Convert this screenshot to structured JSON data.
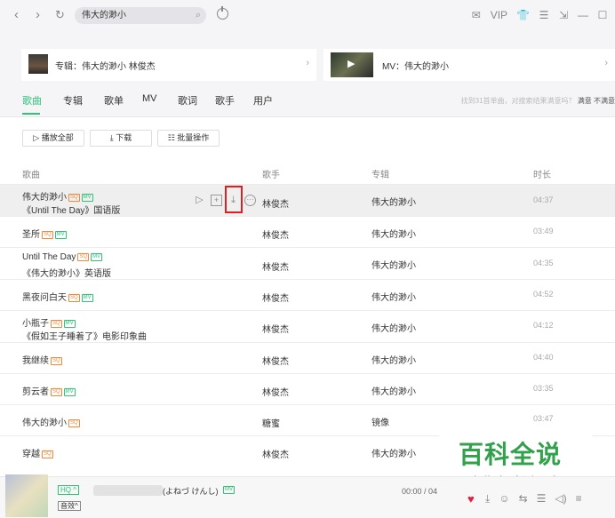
{
  "topbar": {
    "back": "‹",
    "forward": "›",
    "refresh": "↻",
    "search_value": "伟大的渺小",
    "search_icon": "⌕",
    "right_icons": [
      "✉",
      "VIP",
      "👕",
      "☰",
      "⇲",
      "—",
      "☐"
    ]
  },
  "cards": {
    "album_text": "专辑：伟大的渺小    林俊杰",
    "mv_text": "MV：伟大的渺小",
    "chevron": "›"
  },
  "tabs": [
    "歌曲",
    "专辑",
    "歌单",
    "MV",
    "歌词",
    "歌手",
    "用户"
  ],
  "feedback": {
    "text": "找到31首单曲，对搜索结果满意吗？",
    "yes": "满意",
    "no": "不满意"
  },
  "actions": {
    "play_all": "▷ 播放全部",
    "download": "⤓ 下载",
    "batch": "☷ 批量操作"
  },
  "table": {
    "headers": [
      "歌曲",
      "歌手",
      "专辑",
      "时长"
    ],
    "badge_sq": "SQ",
    "badge_mv": "MV",
    "rows": [
      {
        "title": "伟大的渺小",
        "subtitle": "《Until The Day》国语版",
        "singer": "林俊杰",
        "album": "伟大的渺小",
        "duration": "04:37"
      },
      {
        "title": "圣所",
        "subtitle": "",
        "singer": "林俊杰",
        "album": "伟大的渺小",
        "duration": "03:49"
      },
      {
        "title": "Until The Day",
        "subtitle": "《伟大的渺小》英语版",
        "singer": "林俊杰",
        "album": "伟大的渺小",
        "duration": "04:35"
      },
      {
        "title": "黑夜问白天",
        "subtitle": "",
        "singer": "林俊杰",
        "album": "伟大的渺小",
        "duration": "04:52"
      },
      {
        "title": "小瓶子",
        "subtitle": "《假如王子睡着了》电影印象曲",
        "singer": "林俊杰",
        "album": "伟大的渺小",
        "duration": "04:12"
      },
      {
        "title": "我继续",
        "subtitle": "",
        "singer": "林俊杰",
        "album": "伟大的渺小",
        "duration": "04:40"
      },
      {
        "title": "剪云者",
        "subtitle": "",
        "singer": "林俊杰",
        "album": "伟大的渺小",
        "duration": "03:35"
      },
      {
        "title": "伟大的渺小",
        "subtitle": "",
        "singer": "糖蜜",
        "album": "镜像",
        "duration": "03:47"
      },
      {
        "title": "穿越",
        "subtitle": "",
        "singer": "林俊杰",
        "album": "伟大的渺小",
        "duration": ""
      }
    ]
  },
  "watermark": {
    "title": "百科全说",
    "subtitle": "助你轻松解决"
  },
  "player": {
    "hq": "HQ ^",
    "effect": "音效^",
    "artist": "(よねづ けんし)",
    "mv": "MV",
    "time": "00:00 / 04",
    "icons": [
      "⤓",
      "☺",
      "⇆",
      "☰",
      "◁)",
      "≡"
    ]
  }
}
